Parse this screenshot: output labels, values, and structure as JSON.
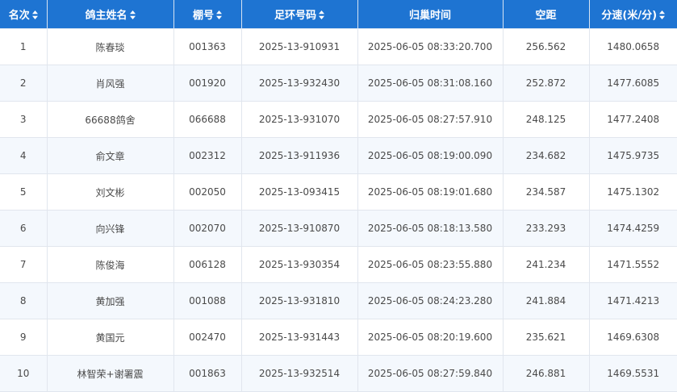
{
  "table": {
    "columns": [
      {
        "label": "名次",
        "sortable": true
      },
      {
        "label": "鸽主姓名",
        "sortable": true
      },
      {
        "label": "棚号",
        "sortable": true
      },
      {
        "label": "足环号码",
        "sortable": true
      },
      {
        "label": "归巢时间",
        "sortable": false
      },
      {
        "label": "空距",
        "sortable": false
      },
      {
        "label": "分速(米/分)",
        "sortable": true
      }
    ],
    "rows": [
      [
        "1",
        "陈春琰",
        "001363",
        "2025-13-910931",
        "2025-06-05 08:33:20.700",
        "256.562",
        "1480.0658"
      ],
      [
        "2",
        "肖风强",
        "001920",
        "2025-13-932430",
        "2025-06-05 08:31:08.160",
        "252.872",
        "1477.6085"
      ],
      [
        "3",
        "66688鸽舍",
        "066688",
        "2025-13-931070",
        "2025-06-05 08:27:57.910",
        "248.125",
        "1477.2408"
      ],
      [
        "4",
        "俞文章",
        "002312",
        "2025-13-911936",
        "2025-06-05 08:19:00.090",
        "234.682",
        "1475.9735"
      ],
      [
        "5",
        "刘文彬",
        "002050",
        "2025-13-093415",
        "2025-06-05 08:19:01.680",
        "234.587",
        "1475.1302"
      ],
      [
        "6",
        "向兴锋",
        "002070",
        "2025-13-910870",
        "2025-06-05 08:18:13.580",
        "233.293",
        "1474.4259"
      ],
      [
        "7",
        "陈俊海",
        "006128",
        "2025-13-930354",
        "2025-06-05 08:23:55.880",
        "241.234",
        "1471.5552"
      ],
      [
        "8",
        "黄加强",
        "001088",
        "2025-13-931810",
        "2025-06-05 08:24:23.280",
        "241.884",
        "1471.4213"
      ],
      [
        "9",
        "黄国元",
        "002470",
        "2025-13-931443",
        "2025-06-05 08:20:19.600",
        "235.621",
        "1469.6308"
      ],
      [
        "10",
        "林智荣+谢署震",
        "001863",
        "2025-13-932514",
        "2025-06-05 08:27:59.840",
        "246.881",
        "1469.5531"
      ]
    ]
  },
  "colors": {
    "header_bg": "#1e74d2",
    "header_text": "#ffffff",
    "row_alt_bg": "#f4f8fd",
    "cell_text": "#4a4a4a"
  },
  "icons": {
    "sort": "sort-icon"
  }
}
